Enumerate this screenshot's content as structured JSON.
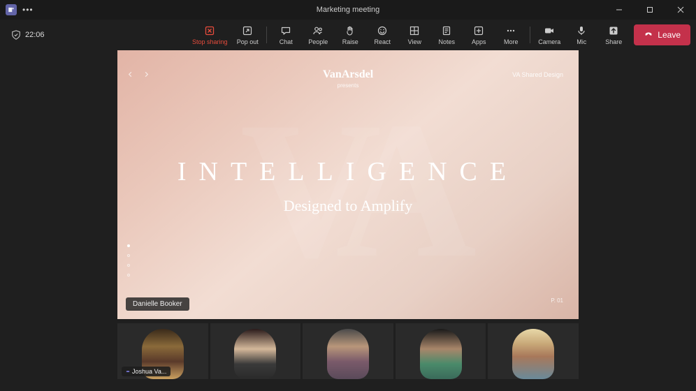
{
  "titlebar": {
    "title": "Marketing meeting"
  },
  "toolbar": {
    "timer": "22:06",
    "items": [
      {
        "id": "stop-sharing",
        "label": "Stop sharing"
      },
      {
        "id": "pop-out",
        "label": "Pop out"
      },
      {
        "id": "chat",
        "label": "Chat"
      },
      {
        "id": "people",
        "label": "People"
      },
      {
        "id": "raise",
        "label": "Raise"
      },
      {
        "id": "react",
        "label": "React"
      },
      {
        "id": "view",
        "label": "View"
      },
      {
        "id": "notes",
        "label": "Notes"
      },
      {
        "id": "apps",
        "label": "Apps"
      },
      {
        "id": "more",
        "label": "More"
      },
      {
        "id": "camera",
        "label": "Camera"
      },
      {
        "id": "mic",
        "label": "Mic"
      },
      {
        "id": "share",
        "label": "Share"
      }
    ],
    "leave": "Leave"
  },
  "slide": {
    "brand": "VanArsdel",
    "brandSub": "presents",
    "corner": "VA Shared Design",
    "title": "INTELLIGENCE",
    "subtitle": "Designed to Amplify",
    "pageNum": "P. 01",
    "presenterLabel": "Danielle Booker"
  },
  "participants": [
    {
      "label": "Joshua Va..."
    }
  ]
}
